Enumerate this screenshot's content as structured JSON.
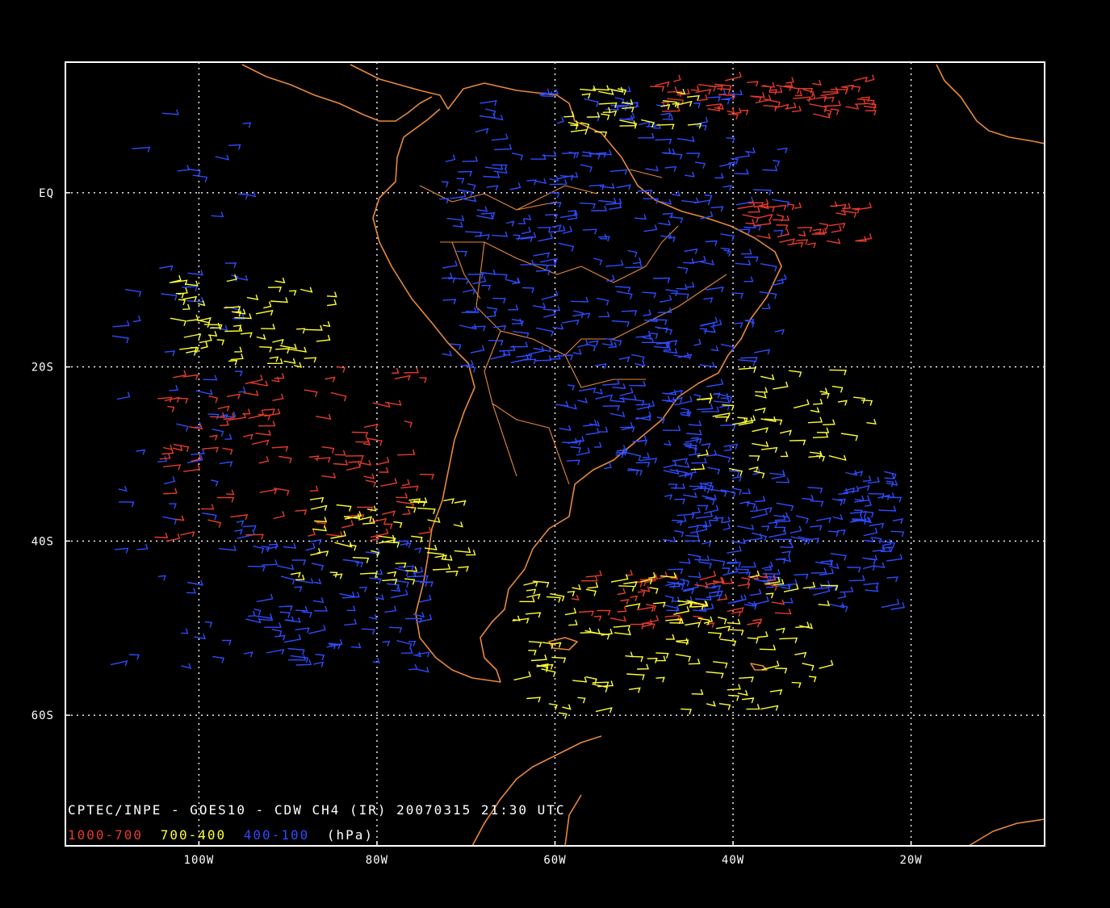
{
  "map": {
    "caption": "CPTEC/INPE - GOES10 - CDW CH4 (IR) 20070315 21:30 UTC",
    "legend": {
      "low": "1000-700",
      "mid": "700-400",
      "high": "400-100",
      "unit": "(hPa)"
    },
    "x_ticks": [
      "100W",
      "80W",
      "60W",
      "40W",
      "20W"
    ],
    "y_ticks": [
      "EQ",
      "20S",
      "40S",
      "60S"
    ],
    "extent": {
      "lon_min": -115,
      "lon_max": -5,
      "lat_min": -75,
      "lat_max": 15
    },
    "colors": {
      "background": "#000000",
      "frame": "#ffffff",
      "grid": "#ffffff",
      "coast": "#e8883a",
      "low_level": "#e83b2c",
      "mid_level": "#ffff33",
      "high_level": "#2d4cff"
    }
  }
}
